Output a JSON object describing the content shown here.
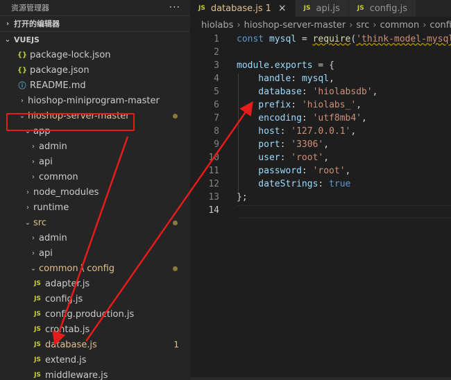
{
  "sidebar": {
    "title": "资源管理器",
    "more": "···",
    "open_editors": "打开的编辑器",
    "workspace": "VUEJS",
    "items": [
      {
        "label": "package-lock.json",
        "icon": "json-icon",
        "indent": 1
      },
      {
        "label": "package.json",
        "icon": "json-icon",
        "indent": 1
      },
      {
        "label": "README.md",
        "icon": "info-icon",
        "indent": 1
      },
      {
        "label": "hioshop-miniprogram-master",
        "chevron": "›",
        "indent": 1
      },
      {
        "label": "hioshop-server-master",
        "chevron": "⌄",
        "indent": 1,
        "git": true,
        "dot": true
      },
      {
        "label": "app",
        "chevron": "⌄",
        "indent": 2
      },
      {
        "label": "admin",
        "chevron": "›",
        "indent": 3
      },
      {
        "label": "api",
        "chevron": "›",
        "indent": 3
      },
      {
        "label": "common",
        "chevron": "›",
        "indent": 3
      },
      {
        "label": "node_modules",
        "chevron": "›",
        "indent": 2
      },
      {
        "label": "runtime",
        "chevron": "›",
        "indent": 2
      },
      {
        "label": "src",
        "chevron": "⌄",
        "indent": 2,
        "git": true,
        "dot": true
      },
      {
        "label": "admin",
        "chevron": "›",
        "indent": 3
      },
      {
        "label": "api",
        "chevron": "›",
        "indent": 3
      },
      {
        "label": "common \\ config",
        "chevron": "⌄",
        "indent": 3,
        "git": true,
        "dot": true
      },
      {
        "label": "adapter.js",
        "icon": "js-icon",
        "indent": 4
      },
      {
        "label": "config.js",
        "icon": "js-icon",
        "indent": 4
      },
      {
        "label": "config.production.js",
        "icon": "js-icon",
        "indent": 4
      },
      {
        "label": "crontab.js",
        "icon": "js-icon",
        "indent": 4
      },
      {
        "label": "database.js",
        "icon": "js-icon",
        "indent": 4,
        "git": true,
        "badge": "1"
      },
      {
        "label": "extend.js",
        "icon": "js-icon",
        "indent": 4
      },
      {
        "label": "middleware.js",
        "icon": "js-icon",
        "indent": 4
      }
    ]
  },
  "tabs": [
    {
      "icon": "JS",
      "label": "database.js",
      "modified": "1",
      "close": "×",
      "active": true
    },
    {
      "icon": "JS",
      "label": "api.js"
    },
    {
      "icon": "JS",
      "label": "config.js"
    }
  ],
  "breadcrumb": [
    "hiolabs",
    "hioshop-server-master",
    "src",
    "common",
    "config",
    "JS"
  ],
  "code": {
    "lines": [
      [
        {
          "t": "const ",
          "c": "k"
        },
        {
          "t": "mysql",
          "c": "v"
        },
        {
          "t": " = ",
          "c": "p"
        },
        {
          "t": "require",
          "c": "f",
          "sq": true
        },
        {
          "t": "(",
          "c": "p"
        },
        {
          "t": "'think-model-mysql'",
          "c": "s",
          "sq": true
        }
      ],
      [],
      [
        {
          "t": "module",
          "c": "v"
        },
        {
          "t": ".",
          "c": "p"
        },
        {
          "t": "exports",
          "c": "v"
        },
        {
          "t": " = {",
          "c": "p"
        }
      ],
      [
        {
          "t": "    handle",
          "c": "v"
        },
        {
          "t": ": ",
          "c": "p"
        },
        {
          "t": "mysql",
          "c": "v"
        },
        {
          "t": ",",
          "c": "p"
        }
      ],
      [
        {
          "t": "    database",
          "c": "v"
        },
        {
          "t": ": ",
          "c": "p"
        },
        {
          "t": "'hiolabsdb'",
          "c": "s"
        },
        {
          "t": ",",
          "c": "p"
        }
      ],
      [
        {
          "t": "    prefix",
          "c": "v"
        },
        {
          "t": ": ",
          "c": "p"
        },
        {
          "t": "'hiolabs_'",
          "c": "s"
        },
        {
          "t": ",",
          "c": "p"
        }
      ],
      [
        {
          "t": "    encoding",
          "c": "v"
        },
        {
          "t": ": ",
          "c": "p"
        },
        {
          "t": "'utf8mb4'",
          "c": "s"
        },
        {
          "t": ",",
          "c": "p"
        }
      ],
      [
        {
          "t": "    host",
          "c": "v"
        },
        {
          "t": ": ",
          "c": "p"
        },
        {
          "t": "'127.0.0.1'",
          "c": "s"
        },
        {
          "t": ",",
          "c": "p"
        }
      ],
      [
        {
          "t": "    port",
          "c": "v"
        },
        {
          "t": ": ",
          "c": "p"
        },
        {
          "t": "'3306'",
          "c": "s"
        },
        {
          "t": ",",
          "c": "p"
        }
      ],
      [
        {
          "t": "    user",
          "c": "v"
        },
        {
          "t": ": ",
          "c": "p"
        },
        {
          "t": "'root'",
          "c": "s"
        },
        {
          "t": ",",
          "c": "p"
        }
      ],
      [
        {
          "t": "    password",
          "c": "v"
        },
        {
          "t": ": ",
          "c": "p"
        },
        {
          "t": "'root'",
          "c": "s"
        },
        {
          "t": ",",
          "c": "p"
        }
      ],
      [
        {
          "t": "    dateStrings",
          "c": "v"
        },
        {
          "t": ": ",
          "c": "p"
        },
        {
          "t": "true",
          "c": "k"
        }
      ],
      [
        {
          "t": "};",
          "c": "p"
        }
      ],
      []
    ],
    "current_line": 14
  },
  "colors": {
    "annotation": "#e81b1b",
    "git_modified": "#e2c08d",
    "js_icon": "#cbcb41"
  }
}
